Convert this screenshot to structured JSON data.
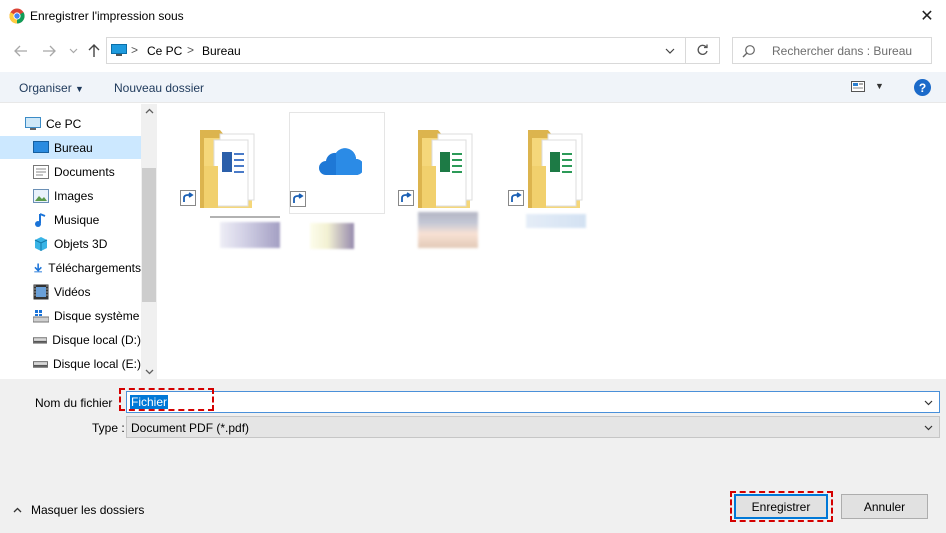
{
  "window": {
    "title": "Enregistrer l'impression sous",
    "close_glyph": "✕"
  },
  "address": {
    "segments": [
      "Ce PC",
      "Bureau"
    ],
    "separator": ">"
  },
  "search": {
    "placeholder": "Rechercher dans : Bureau"
  },
  "toolbar": {
    "organize_label": "Organiser",
    "new_folder_label": "Nouveau dossier"
  },
  "sidebar": {
    "items": [
      {
        "label": "Ce PC",
        "icon": "computer-icon",
        "selected": false
      },
      {
        "label": "Bureau",
        "icon": "desktop-icon",
        "selected": true
      },
      {
        "label": "Documents",
        "icon": "documents-icon",
        "selected": false
      },
      {
        "label": "Images",
        "icon": "images-icon",
        "selected": false
      },
      {
        "label": "Musique",
        "icon": "music-icon",
        "selected": false
      },
      {
        "label": "Objets 3D",
        "icon": "3d-objects-icon",
        "selected": false
      },
      {
        "label": "Téléchargements",
        "icon": "downloads-icon",
        "selected": false
      },
      {
        "label": "Vidéos",
        "icon": "videos-icon",
        "selected": false
      },
      {
        "label": "Disque système",
        "icon": "system-drive-icon",
        "selected": false
      },
      {
        "label": "Disque local (D:)",
        "icon": "drive-icon",
        "selected": false
      },
      {
        "label": "Disque local (E:)",
        "icon": "drive-icon",
        "selected": false
      }
    ]
  },
  "files": [
    {
      "kind": "word-folder",
      "icon": "word-folder-shortcut-icon"
    },
    {
      "kind": "onedrive",
      "icon": "onedrive-shortcut-icon"
    },
    {
      "kind": "excel-folder",
      "icon": "excel-folder-shortcut-icon"
    },
    {
      "kind": "excel-folder",
      "icon": "excel-folder-shortcut-icon"
    }
  ],
  "form": {
    "filename_label": "Nom du fichier",
    "filename_value": "Fichier",
    "type_label": "Type :",
    "type_value": "Document PDF (*.pdf)"
  },
  "footer": {
    "hide_folders_label": "Masquer les dossiers",
    "save_label": "Enregistrer",
    "cancel_label": "Annuler"
  },
  "colors": {
    "accent": "#0078d7",
    "selection_bg": "#cce8ff",
    "highlight_dash": "#d40000",
    "toolbar_bg": "#f0f4f9",
    "bottom_bg": "#f0f0f0"
  }
}
